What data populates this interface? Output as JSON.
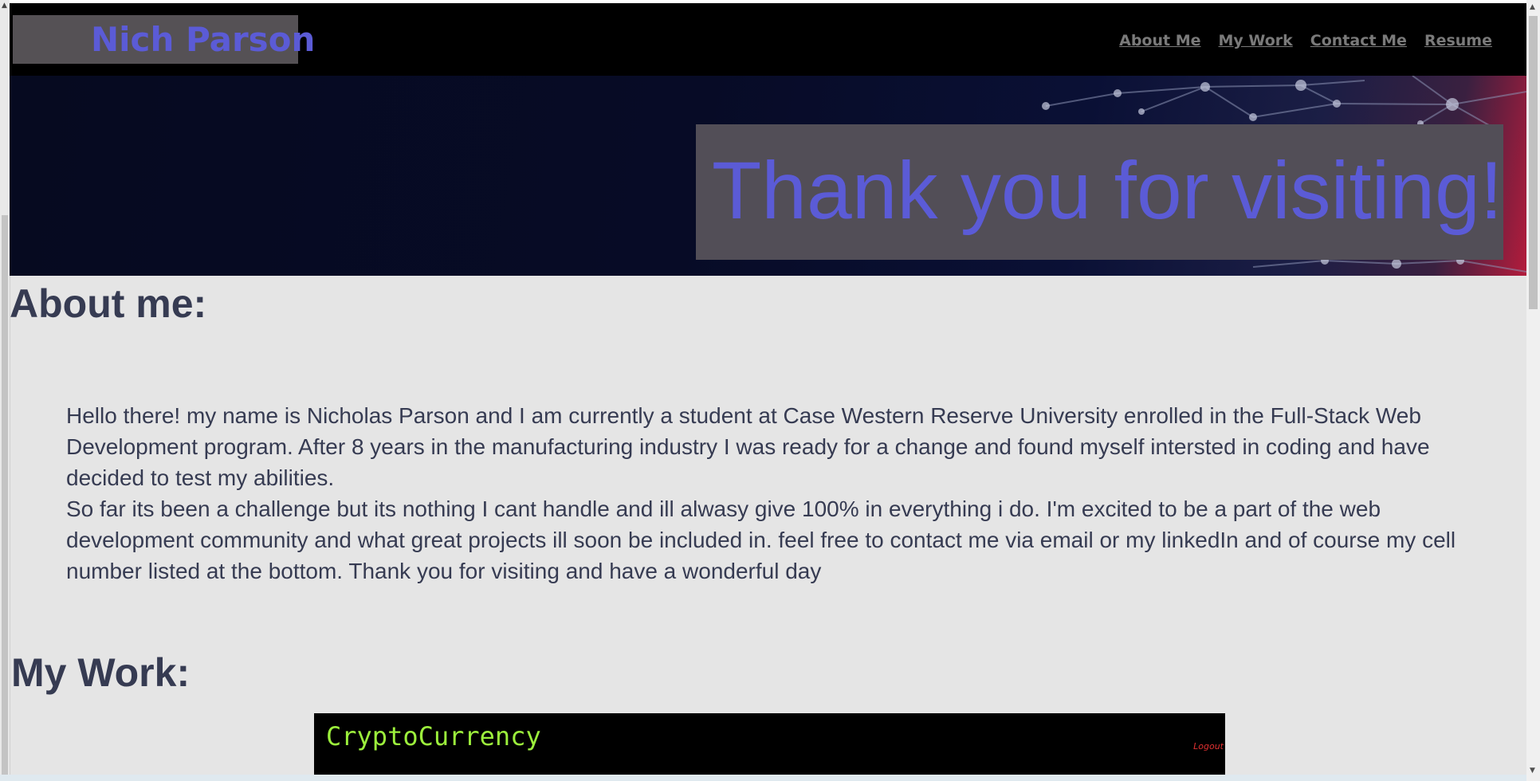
{
  "header": {
    "brand": "Nich Parson",
    "nav": [
      {
        "label": "About Me"
      },
      {
        "label": "My Work"
      },
      {
        "label": "Contact Me"
      },
      {
        "label": "Resume"
      }
    ]
  },
  "hero": {
    "title": "Thank you for visiting!"
  },
  "about": {
    "title": "About me:",
    "paragraphs": [
      "Hello there! my name is Nicholas Parson and I am currently a student at Case Western Reserve University enrolled in the Full-Stack Web Development program. After 8 years in the manufacturing industry I was ready for a change and found myself intersted in coding and have decided to test my abilities.",
      "So far its been a challenge but its nothing I cant handle and ill alwasy give 100% in everything i do. I'm excited to be a part of the web development community and what great projects ill soon be included in. feel free to contact me via email or my linkedIn and of course my cell number listed at the bottom. Thank you for visiting and have a wonderful day"
    ]
  },
  "work": {
    "title": "My Work:",
    "projects": [
      {
        "name": "CryptoCurrency",
        "logout_label": "Logout"
      }
    ]
  },
  "colors": {
    "accent": "#5b5bd6",
    "header_bg": "#000000",
    "body_bg": "#e5e5e5",
    "text": "#363b52",
    "project_title": "#9cf03c"
  }
}
